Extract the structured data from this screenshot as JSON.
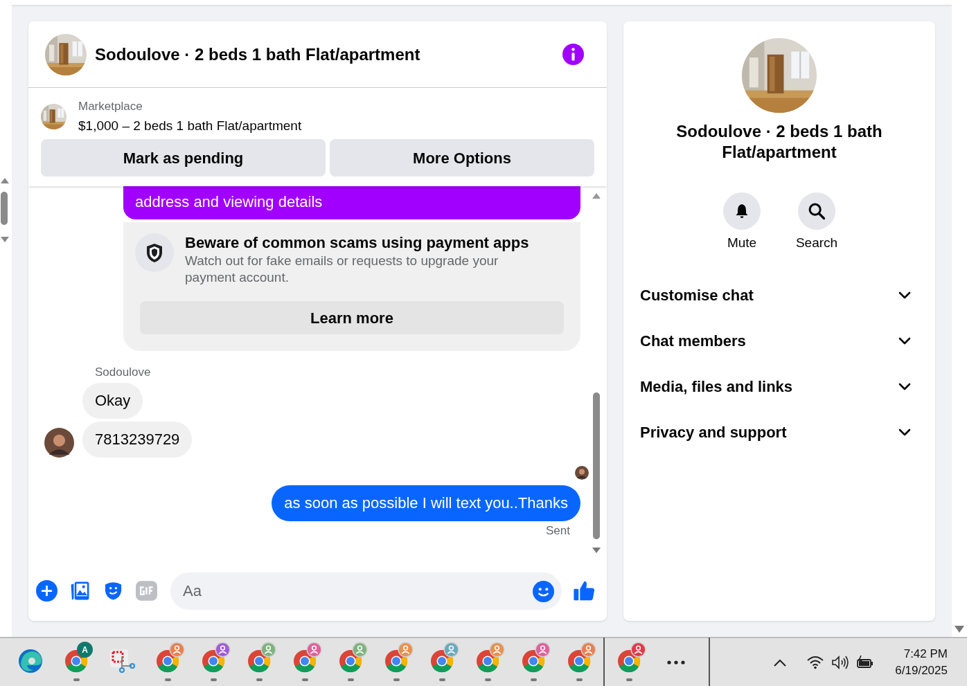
{
  "conversation": {
    "title": "Sodoulove · 2 beds 1 bath Flat/apartment"
  },
  "listing": {
    "source": "Marketplace",
    "summary": "$1,000 – 2 beds 1 bath Flat/apartment",
    "buttons": [
      "Mark as pending",
      "More Options"
    ]
  },
  "messages": [
    {
      "kind": "outgoing",
      "text": "address and viewing details",
      "color": "#a100ff"
    },
    {
      "kind": "notice",
      "title": "Beware of common scams using payment apps",
      "body": "Watch out for fake emails or requests to upgrade your payment account.",
      "button": "Learn more"
    },
    {
      "kind": "sender",
      "text": "Sodoulove"
    },
    {
      "kind": "incoming",
      "text": "Okay",
      "avatar": false
    },
    {
      "kind": "incoming",
      "text": "7813239729",
      "avatar": true
    },
    {
      "kind": "read_receipt"
    },
    {
      "kind": "outgoing",
      "text": "as soon as possible I will text you..Thanks",
      "color": "#0866ff"
    },
    {
      "kind": "status",
      "text": "Sent"
    }
  ],
  "composer": {
    "placeholder": "Aa"
  },
  "details": {
    "title": "Sodoulove · 2 beds 1 bath Flat/apartment",
    "actions": [
      {
        "kind": "bell",
        "label": "Mute"
      },
      {
        "kind": "search",
        "label": "Search"
      }
    ],
    "sections": [
      {
        "label": "Customise chat",
        "expanded": false
      },
      {
        "label": "Chat members",
        "expanded": false
      },
      {
        "label": "Media, files and links",
        "expanded": false
      },
      {
        "label": "Privacy and support",
        "expanded": false
      }
    ]
  },
  "taskbar": {
    "apps": [
      {
        "kind": "edge",
        "running": false
      },
      {
        "kind": "chrome",
        "badge": "A",
        "color": "#0f7a6c",
        "running": true
      },
      {
        "kind": "snipping",
        "running": false
      },
      {
        "kind": "chrome",
        "color": "#e8804f",
        "running": true
      },
      {
        "kind": "chrome",
        "color": "#a25bd6",
        "running": true
      },
      {
        "kind": "chrome",
        "color": "#7fb27f",
        "running": true
      },
      {
        "kind": "chrome",
        "color": "#e0609a",
        "running": true
      },
      {
        "kind": "chrome",
        "color": "#7fb27f",
        "running": true
      },
      {
        "kind": "chrome",
        "color": "#e8904f",
        "running": true
      },
      {
        "kind": "chrome",
        "color": "#6aaabb",
        "running": true
      },
      {
        "kind": "chrome",
        "color": "#e8904f",
        "running": true
      },
      {
        "kind": "chrome",
        "color": "#e0609a",
        "running": true
      },
      {
        "kind": "chrome",
        "color": "#e8804f",
        "running": true
      }
    ],
    "open": [
      {
        "kind": "chrome",
        "color": "#e03a4a",
        "running": true
      }
    ],
    "time": "7:42 PM",
    "date": "6/19/2025"
  }
}
